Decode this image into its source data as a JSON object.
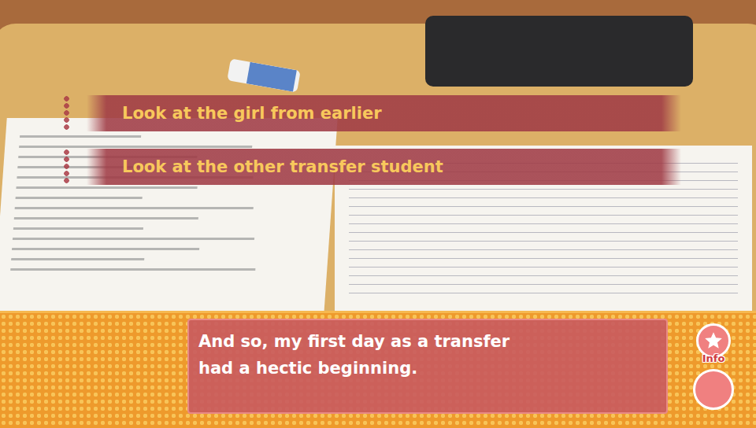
{
  "choices": [
    {
      "label": "Look at the girl from earlier",
      "selected": false
    },
    {
      "label": "Look at the other transfer student",
      "selected": false
    }
  ],
  "dialogue": {
    "lines": [
      "And so, my first day as a transfer",
      "had a hectic beginning."
    ]
  },
  "controls": {
    "info_label": "Info"
  }
}
